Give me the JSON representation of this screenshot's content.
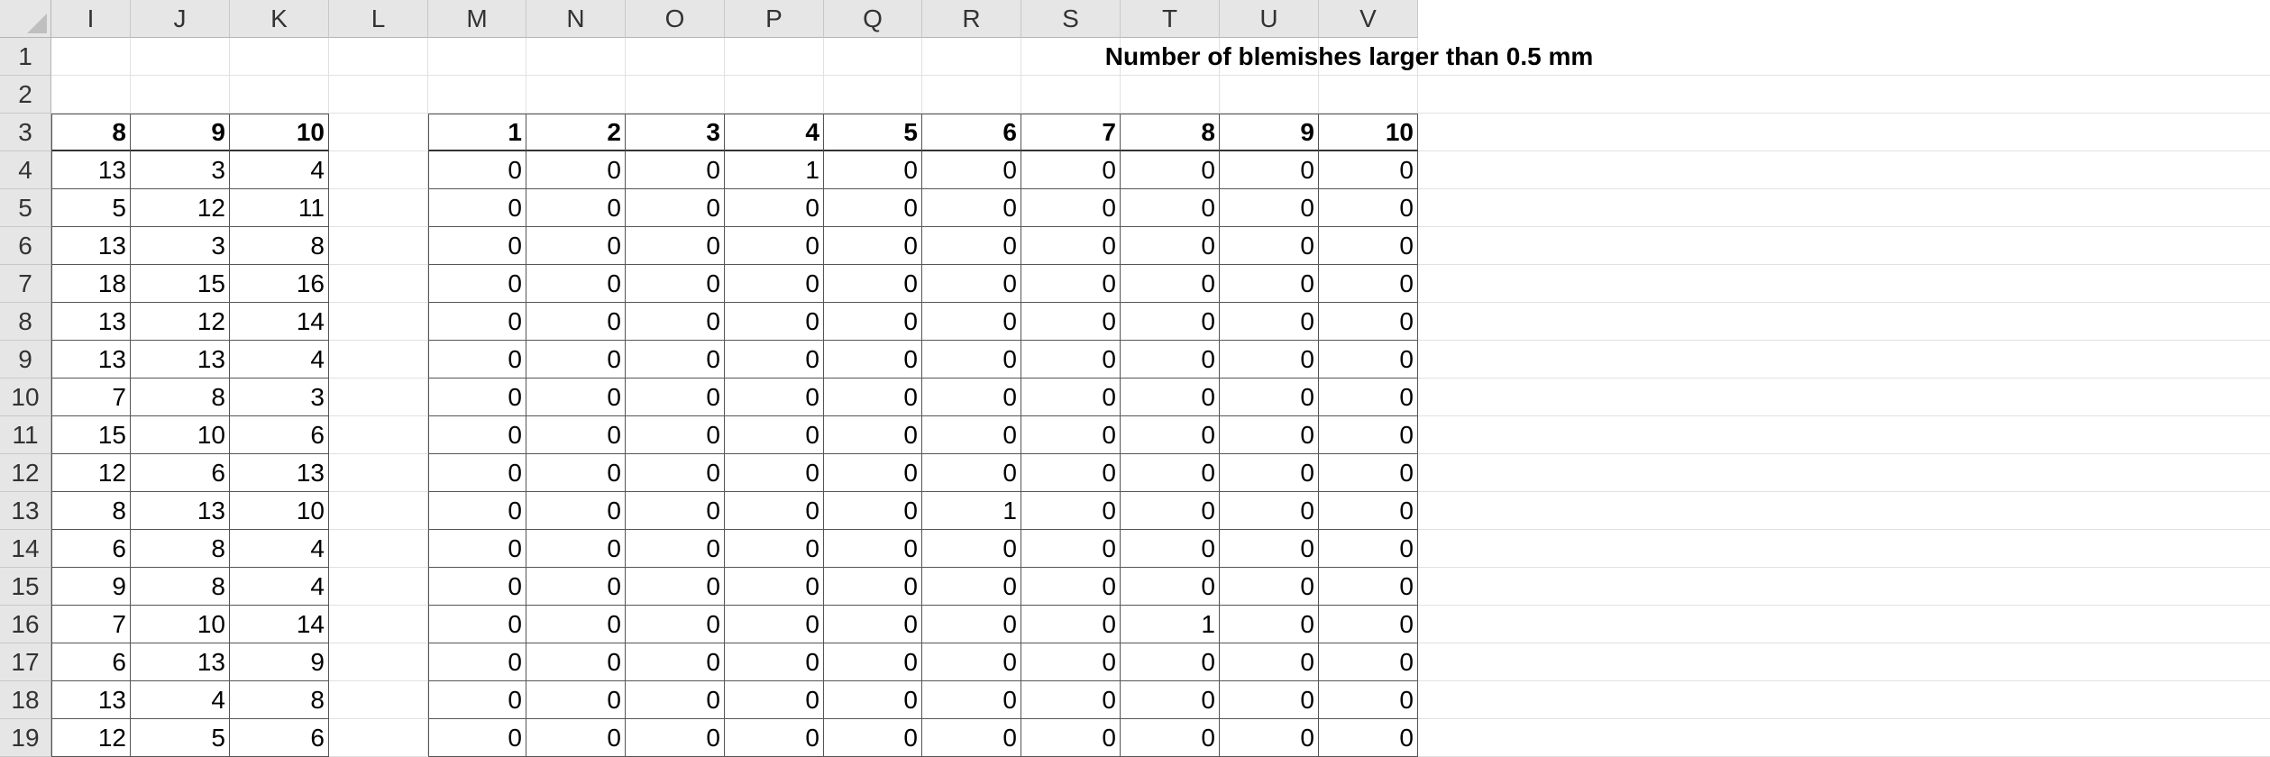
{
  "columns": [
    "I",
    "J",
    "K",
    "L",
    "M",
    "N",
    "O",
    "P",
    "Q",
    "R",
    "S",
    "T",
    "U",
    "V"
  ],
  "rows": [
    "1",
    "2",
    "3",
    "4",
    "5",
    "6",
    "7",
    "8",
    "9",
    "10",
    "11",
    "12",
    "13",
    "14",
    "15",
    "16",
    "17",
    "18",
    "19"
  ],
  "title": "Number of blemishes larger than 0.5 mm",
  "left_table": {
    "headers": [
      "8",
      "9",
      "10"
    ],
    "data": [
      [
        "13",
        "3",
        "4"
      ],
      [
        "5",
        "12",
        "11"
      ],
      [
        "13",
        "3",
        "8"
      ],
      [
        "18",
        "15",
        "16"
      ],
      [
        "13",
        "12",
        "14"
      ],
      [
        "13",
        "13",
        "4"
      ],
      [
        "7",
        "8",
        "3"
      ],
      [
        "15",
        "10",
        "6"
      ],
      [
        "12",
        "6",
        "13"
      ],
      [
        "8",
        "13",
        "10"
      ],
      [
        "6",
        "8",
        "4"
      ],
      [
        "9",
        "8",
        "4"
      ],
      [
        "7",
        "10",
        "14"
      ],
      [
        "6",
        "13",
        "9"
      ],
      [
        "13",
        "4",
        "8"
      ],
      [
        "12",
        "5",
        "6"
      ]
    ]
  },
  "right_table": {
    "headers": [
      "1",
      "2",
      "3",
      "4",
      "5",
      "6",
      "7",
      "8",
      "9",
      "10"
    ],
    "data": [
      [
        "0",
        "0",
        "0",
        "1",
        "0",
        "0",
        "0",
        "0",
        "0",
        "0"
      ],
      [
        "0",
        "0",
        "0",
        "0",
        "0",
        "0",
        "0",
        "0",
        "0",
        "0"
      ],
      [
        "0",
        "0",
        "0",
        "0",
        "0",
        "0",
        "0",
        "0",
        "0",
        "0"
      ],
      [
        "0",
        "0",
        "0",
        "0",
        "0",
        "0",
        "0",
        "0",
        "0",
        "0"
      ],
      [
        "0",
        "0",
        "0",
        "0",
        "0",
        "0",
        "0",
        "0",
        "0",
        "0"
      ],
      [
        "0",
        "0",
        "0",
        "0",
        "0",
        "0",
        "0",
        "0",
        "0",
        "0"
      ],
      [
        "0",
        "0",
        "0",
        "0",
        "0",
        "0",
        "0",
        "0",
        "0",
        "0"
      ],
      [
        "0",
        "0",
        "0",
        "0",
        "0",
        "0",
        "0",
        "0",
        "0",
        "0"
      ],
      [
        "0",
        "0",
        "0",
        "0",
        "0",
        "0",
        "0",
        "0",
        "0",
        "0"
      ],
      [
        "0",
        "0",
        "0",
        "0",
        "0",
        "1",
        "0",
        "0",
        "0",
        "0"
      ],
      [
        "0",
        "0",
        "0",
        "0",
        "0",
        "0",
        "0",
        "0",
        "0",
        "0"
      ],
      [
        "0",
        "0",
        "0",
        "0",
        "0",
        "0",
        "0",
        "0",
        "0",
        "0"
      ],
      [
        "0",
        "0",
        "0",
        "0",
        "0",
        "0",
        "0",
        "1",
        "0",
        "0"
      ],
      [
        "0",
        "0",
        "0",
        "0",
        "0",
        "0",
        "0",
        "0",
        "0",
        "0"
      ],
      [
        "0",
        "0",
        "0",
        "0",
        "0",
        "0",
        "0",
        "0",
        "0",
        "0"
      ],
      [
        "0",
        "0",
        "0",
        "0",
        "0",
        "0",
        "0",
        "0",
        "0",
        "0"
      ]
    ]
  }
}
